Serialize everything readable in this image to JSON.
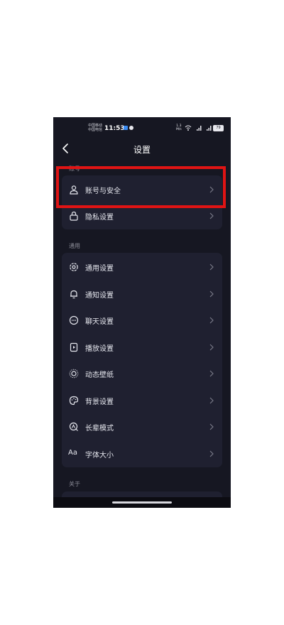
{
  "status_bar": {
    "carrier1": "中国移动",
    "carrier2": "中国电信",
    "time": "11:53",
    "net_speed_value": "1.3",
    "net_speed_unit": "M/s",
    "battery": "79"
  },
  "header": {
    "title": "设置"
  },
  "sections": {
    "account": {
      "label": "账号",
      "items": [
        "账号与安全",
        "隐私设置"
      ]
    },
    "general": {
      "label": "通用",
      "items": [
        "通用设置",
        "通知设置",
        "聊天设置",
        "播放设置",
        "动态壁纸",
        "背景设置",
        "长辈模式",
        "字体大小"
      ]
    },
    "about": {
      "label": "关于"
    }
  },
  "font_icon_text": "Aa",
  "colors": {
    "background": "#161722",
    "card": "#1f2030",
    "highlight": "#e01414"
  }
}
